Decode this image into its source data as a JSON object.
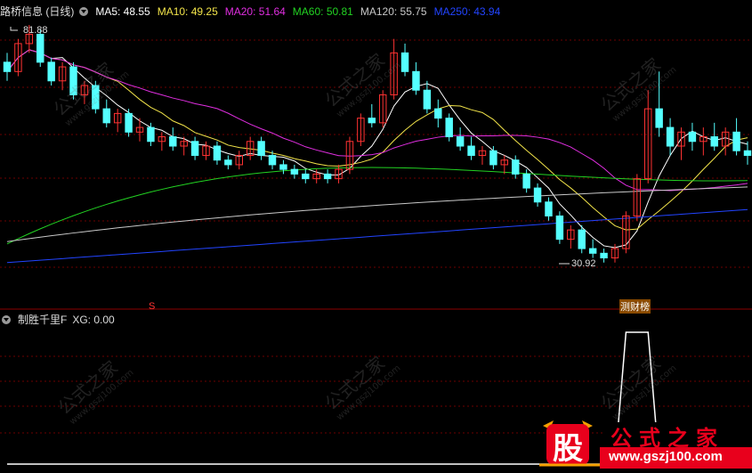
{
  "header": {
    "title": "路桥信息 (日线)",
    "ma": [
      {
        "label": "MA5: 48.55",
        "color": "#ffffff"
      },
      {
        "label": "MA10: 49.25",
        "color": "#f2e44a"
      },
      {
        "label": "MA20: 51.64",
        "color": "#e02ee0"
      },
      {
        "label": "MA60: 50.81",
        "color": "#22d222"
      },
      {
        "label": "MA120: 55.75",
        "color": "#c8c8c8"
      },
      {
        "label": "MA250: 43.94",
        "color": "#2244ff"
      }
    ]
  },
  "sub_header": {
    "title": "制胜千里F",
    "xg": "XG: 0.00"
  },
  "annotations": {
    "high": "81.88",
    "low": "30.92",
    "marker_s": "S",
    "marker_news": "测财榜"
  },
  "watermark": {
    "text": "公式之家",
    "url": "www.gszj100.com"
  },
  "logo": {
    "char": "股",
    "name": "公式之家",
    "url": "www.gszj100.com"
  },
  "chart_data": {
    "type": "candlestick",
    "high_label": 81.88,
    "low_label": 30.92,
    "candles": [
      [
        74,
        76,
        70,
        72
      ],
      [
        72,
        79,
        71,
        78
      ],
      [
        78,
        82,
        76,
        80
      ],
      [
        80,
        81,
        73,
        74
      ],
      [
        74,
        75,
        69,
        70
      ],
      [
        70,
        74,
        68,
        73
      ],
      [
        73,
        74,
        66,
        67
      ],
      [
        67,
        70,
        65,
        69
      ],
      [
        69,
        70,
        63,
        64
      ],
      [
        64,
        66,
        60,
        61
      ],
      [
        61,
        64,
        59,
        63
      ],
      [
        63,
        64,
        58,
        59
      ],
      [
        59,
        62,
        57,
        60
      ],
      [
        60,
        61,
        56,
        57
      ],
      [
        57,
        59,
        55,
        58
      ],
      [
        58,
        60,
        55,
        56
      ],
      [
        56,
        58,
        54,
        57
      ],
      [
        57,
        58,
        53,
        54
      ],
      [
        54,
        57,
        53,
        56
      ],
      [
        56,
        57,
        52,
        53
      ],
      [
        53,
        54,
        51,
        52
      ],
      [
        52,
        55,
        51,
        54
      ],
      [
        54,
        58,
        53,
        57
      ],
      [
        57,
        58,
        53,
        54
      ],
      [
        54,
        55,
        51,
        52
      ],
      [
        52,
        53,
        50,
        51
      ],
      [
        51,
        52,
        49,
        50
      ],
      [
        50,
        51,
        48,
        49
      ],
      [
        49,
        51,
        48,
        50
      ],
      [
        50,
        51,
        48,
        49
      ],
      [
        49,
        52,
        48,
        51
      ],
      [
        51,
        58,
        50,
        57
      ],
      [
        57,
        63,
        56,
        62
      ],
      [
        62,
        65,
        60,
        61
      ],
      [
        61,
        68,
        60,
        67
      ],
      [
        67,
        79,
        66,
        76
      ],
      [
        76,
        78,
        71,
        72
      ],
      [
        72,
        74,
        67,
        68
      ],
      [
        68,
        70,
        63,
        64
      ],
      [
        64,
        66,
        60,
        62
      ],
      [
        62,
        63,
        57,
        58
      ],
      [
        58,
        60,
        55,
        56
      ],
      [
        56,
        58,
        53,
        54
      ],
      [
        54,
        56,
        52,
        55
      ],
      [
        55,
        56,
        51,
        52
      ],
      [
        52,
        54,
        50,
        53
      ],
      [
        53,
        54,
        49,
        50
      ],
      [
        50,
        51,
        46,
        47
      ],
      [
        47,
        48,
        43,
        44
      ],
      [
        44,
        45,
        40,
        41
      ],
      [
        41,
        42,
        35,
        36
      ],
      [
        36,
        39,
        34,
        38
      ],
      [
        38,
        39,
        33,
        34
      ],
      [
        34,
        36,
        32,
        33
      ],
      [
        33,
        34,
        31,
        32
      ],
      [
        32,
        35,
        31,
        34
      ],
      [
        34,
        42,
        33,
        41
      ],
      [
        41,
        50,
        40,
        49
      ],
      [
        49,
        68,
        48,
        64
      ],
      [
        64,
        72,
        58,
        60
      ],
      [
        60,
        62,
        54,
        56
      ],
      [
        56,
        60,
        53,
        59
      ],
      [
        59,
        61,
        55,
        57
      ],
      [
        57,
        60,
        54,
        58
      ],
      [
        58,
        61,
        55,
        56
      ],
      [
        56,
        60,
        54,
        59
      ],
      [
        59,
        62,
        54,
        55
      ],
      [
        55,
        57,
        52,
        54
      ]
    ],
    "ma_series": [
      {
        "name": "MA5",
        "color": "#ffffff"
      },
      {
        "name": "MA10",
        "color": "#f2e44a"
      },
      {
        "name": "MA20",
        "color": "#e02ee0"
      },
      {
        "name": "MA60",
        "color": "#22d222"
      },
      {
        "name": "MA120",
        "color": "#c8c8c8"
      },
      {
        "name": "MA250",
        "color": "#2244ff"
      }
    ],
    "xg_signal": [
      0,
      0,
      0,
      0,
      0,
      0,
      0,
      0,
      0,
      0,
      0,
      0,
      0,
      0,
      0,
      0,
      0,
      0,
      0,
      0,
      0,
      0,
      0,
      0,
      0,
      0,
      0,
      0,
      0,
      0,
      0,
      0,
      0,
      0,
      0,
      0,
      0,
      0,
      0,
      0,
      0,
      0,
      0,
      0,
      0,
      0,
      0,
      0,
      0,
      0,
      0,
      0,
      0,
      0,
      0,
      0,
      1,
      1,
      1,
      0,
      0,
      0,
      0,
      0,
      0,
      0,
      0,
      0
    ],
    "colors": {
      "up": "#ff3232",
      "down": "#54ffff",
      "grid": "#6b0000"
    }
  }
}
